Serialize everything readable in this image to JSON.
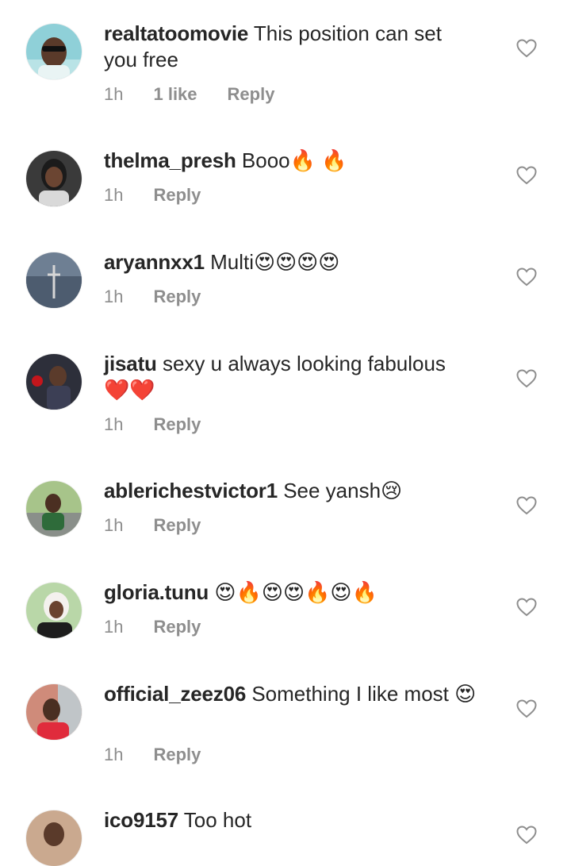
{
  "colors": {
    "text_primary": "#262626",
    "text_secondary": "#8e8e8e",
    "heart_outline": "#8e8e8e",
    "background": "#ffffff"
  },
  "comments": [
    {
      "username": "realtatoomovie",
      "text": "This position can set you free",
      "time": "1h",
      "likes": "1 like",
      "reply": "Reply",
      "like_icon": "heart-outline-icon"
    },
    {
      "username": "thelma_presh",
      "text": "Booo🔥 🔥",
      "time": "1h",
      "reply": "Reply",
      "like_icon": "heart-outline-icon"
    },
    {
      "username": "aryannxx1",
      "text": "Multi😍😍😍😍",
      "time": "1h",
      "reply": "Reply",
      "like_icon": "heart-outline-icon"
    },
    {
      "username": "jisatu",
      "text": "sexy u always looking fabulous ❤️❤️",
      "time": "1h",
      "reply": "Reply",
      "like_icon": "heart-outline-icon"
    },
    {
      "username": "ablerichestvictor1",
      "text": "See yansh😢",
      "time": "1h",
      "reply": "Reply",
      "like_icon": "heart-outline-icon"
    },
    {
      "username": "gloria.tunu",
      "text": "😍🔥😍😍🔥😍🔥",
      "time": "1h",
      "reply": "Reply",
      "like_icon": "heart-outline-icon"
    },
    {
      "username": "official_zeez06",
      "text": "Something I like most 😍",
      "time": "1h",
      "reply": "Reply",
      "like_icon": "heart-outline-icon"
    },
    {
      "username": "ico9157",
      "text": "Too hot",
      "like_icon": "heart-outline-icon"
    }
  ]
}
